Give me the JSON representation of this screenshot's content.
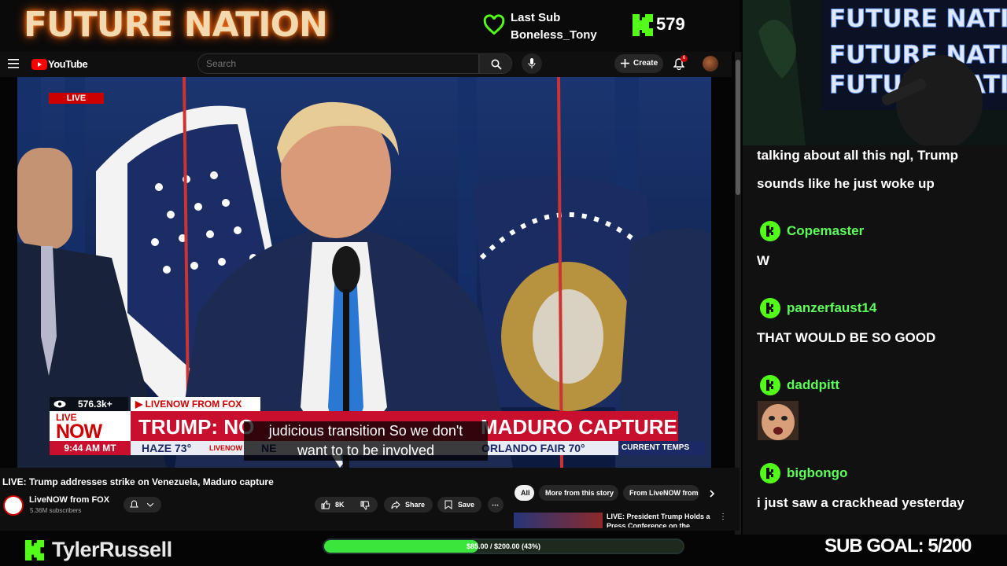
{
  "stream": {
    "brand": "FUTURE NATION",
    "last_sub_label": "Last Sub",
    "last_sub_name": "Boneless_Tony",
    "kick_count": "579",
    "streamer": "TylerRussell",
    "progress_text": "$85.00 / $200.00 (43%)",
    "progress_fraction": 0.43,
    "sub_goal": "SUB GOAL: 5/200",
    "accent": "#53fc18"
  },
  "youtube": {
    "logo_text": "YouTube",
    "search_placeholder": "Search",
    "create_label": "Create",
    "notif_count": "6"
  },
  "video": {
    "live_badge": "LIVE",
    "viewers": "576.3k+",
    "source": "LIVENOW FROM FOX",
    "now_live": "LIVE",
    "now_text": "NOW",
    "headline_left": "TRUMP: NO",
    "headline_right": "MADURO CAPTURE",
    "time": "9:44 AM MT",
    "ticker_1": "HAZE 73°",
    "ticker_2": "ORLANDO  FAIR 70°",
    "ticker_brand": "LIVENOW",
    "ticker_ne": "NE",
    "current_temps": "CURRENT TEMPS",
    "caption_line1": "judicious transition So we don't",
    "caption_line2": "want to to be involved"
  },
  "below": {
    "title": "LIVE: Trump addresses strike on Venezuela, Maduro capture",
    "channel": "LiveNOW from FOX",
    "subscribers": "5.36M subscribers",
    "likes": "8K",
    "share": "Share",
    "save": "Save",
    "chips": [
      "All",
      "More from this story",
      "From LiveNOW from"
    ],
    "rec_title": "LIVE: President Trump Holds a Press Conference on the"
  },
  "chat": {
    "top_msg_1": "talking about all this ngl, Trump",
    "top_msg_2": "sounds like he just woke up",
    "messages": [
      {
        "user": "Copemaster",
        "text": "W"
      },
      {
        "user": "panzerfaust14",
        "text": "THAT WOULD BE SO GOOD"
      },
      {
        "user": "daddpitt",
        "text": ""
      },
      {
        "user": "bigbongo",
        "text": "i just saw a crackhead yesterday"
      }
    ]
  },
  "icons": [
    "heart-icon",
    "kick-icon",
    "menu-icon",
    "youtube-icon",
    "search-icon",
    "mic-icon",
    "plus-icon",
    "bell-icon",
    "avatar",
    "eye-icon",
    "like-icon",
    "dislike-icon",
    "share-icon",
    "save-icon",
    "more-icon",
    "chevron-right-icon"
  ]
}
